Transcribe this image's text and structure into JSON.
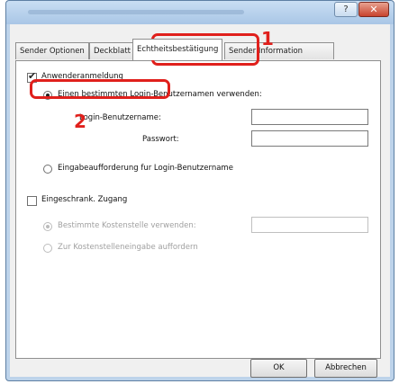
{
  "titlebar": {
    "help_label": "?",
    "close_label": "✕"
  },
  "tabs": [
    {
      "label": "Sender Optionen"
    },
    {
      "label": "Deckblatt"
    },
    {
      "label": "Echtheitsbestätigung"
    },
    {
      "label": "Sender Information"
    }
  ],
  "auth": {
    "user_login": {
      "label": "Anwenderanmeldung",
      "checked": true
    },
    "specific_login": {
      "label": "Einen bestimmten Login-Benutzernamen verwenden:",
      "selected": true
    },
    "username": {
      "label": "Login-Benutzername:",
      "value": ""
    },
    "password": {
      "label": "Passwort:",
      "value": ""
    },
    "prompt_login": {
      "label": "Eingabeaufforderung fur Login-Benutzername",
      "selected": false
    }
  },
  "restricted": {
    "label": "Eingeschrank. Zugang",
    "checked": false,
    "specific_cost": {
      "label": "Bestimmte Kostenstelle verwenden:",
      "selected": true,
      "value": ""
    },
    "prompt_cost": {
      "label": "Zur Kostenstelleneingabe auffordern",
      "selected": false
    }
  },
  "buttons": {
    "ok": "OK",
    "cancel": "Abbrechen"
  },
  "annotations": {
    "marker_1": "1",
    "marker_2": "2"
  },
  "colors": {
    "highlight": "#e0201c",
    "titlebar": "#bdd3ea"
  }
}
